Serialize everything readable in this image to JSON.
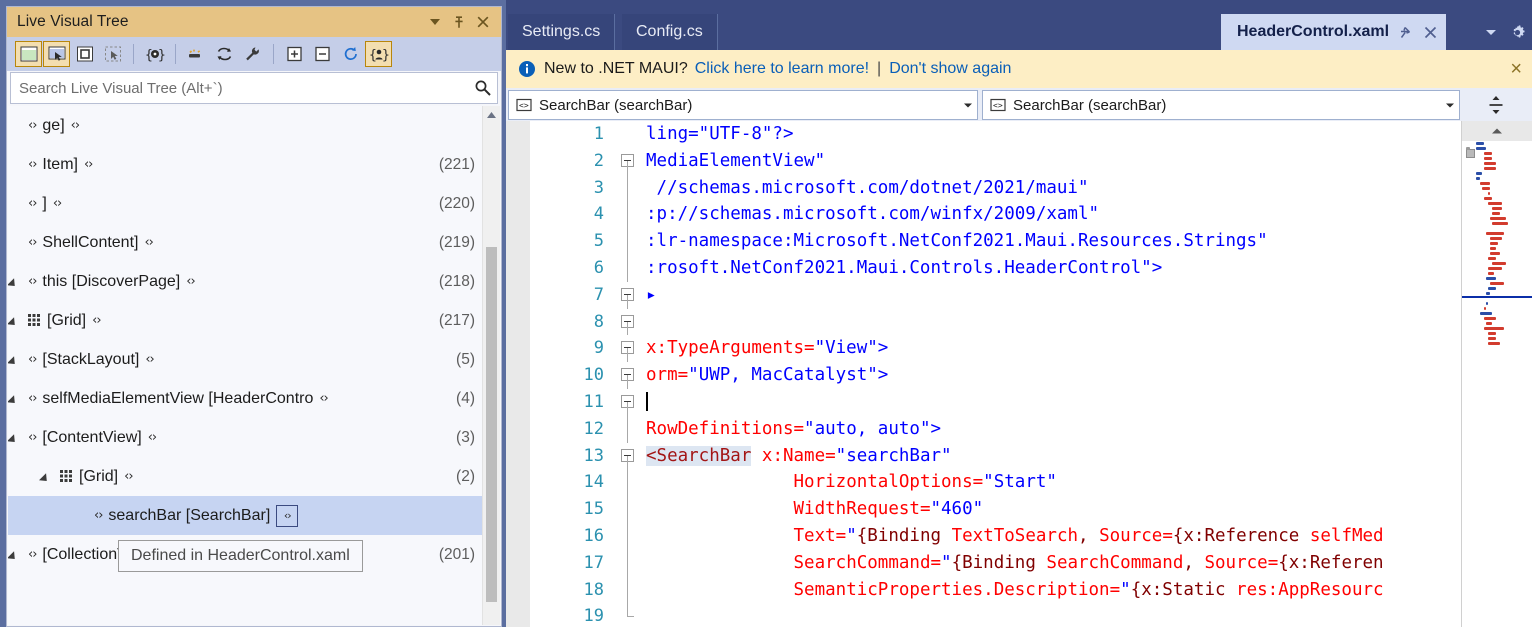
{
  "colors": {
    "tool_title_bg": "#e6c384",
    "tool_toolbar_bg": "#c5cee8",
    "shell_bg": "#5b6ea0",
    "tab_active_bg": "#cfd9f2",
    "tab_inactive_bg": "#36457a",
    "infobar_bg": "#fdeec5",
    "link": "#0a5fb8",
    "selection": "#c6d4f2",
    "linenumber": "#2b91af",
    "element": "#a31515",
    "attribute": "#ff0000",
    "value": "#0000ff"
  },
  "tool_window": {
    "title": "Live Visual Tree",
    "caret_label": "",
    "pin_label": "Pin",
    "close_label": "Close",
    "toolbar_icons": [
      "select-element-icon",
      "display-layout-adorners-icon",
      "preview-selection-icon",
      "track-focused-element-icon",
      "show-runtime-tools-icon",
      "show-in-xaml-editor-icon",
      "refresh-icon",
      "configure-icon",
      "expand-all-icon",
      "collapse-all-icon",
      "reload-icon",
      "show-only-my-xaml-icon"
    ],
    "search": {
      "placeholder": "Search Live Visual Tree (Alt+`)",
      "value": "",
      "icon": "search-icon"
    },
    "tree": [
      {
        "indent": 0,
        "expander": "none",
        "icon": "code-icon",
        "label": "ge]",
        "count": "",
        "selected": false
      },
      {
        "indent": 0,
        "expander": "none",
        "icon": "code-icon",
        "label": "Item]",
        "count": "(221)",
        "selected": false
      },
      {
        "indent": 0,
        "expander": "none",
        "icon": "code-icon",
        "label": "]",
        "count": "(220)",
        "selected": false
      },
      {
        "indent": 0,
        "expander": "none",
        "icon": "code-icon",
        "label": "ShellContent]",
        "count": "(219)",
        "selected": false
      },
      {
        "indent": 0,
        "expander": "open",
        "icon": "code-icon",
        "label": "this [DiscoverPage]",
        "count": "(218)",
        "selected": false
      },
      {
        "indent": 0,
        "expander": "open",
        "icon": "grid-icon",
        "label": "[Grid]",
        "count": "(217)",
        "selected": false
      },
      {
        "indent": 1,
        "expander": "open",
        "icon": "code-icon",
        "label": "[StackLayout]",
        "count": "(5)",
        "selected": false
      },
      {
        "indent": 2,
        "expander": "open",
        "icon": "code-icon",
        "label": "selfMediaElementView [HeaderContro",
        "count": "(4)",
        "selected": false
      },
      {
        "indent": 3,
        "expander": "open",
        "icon": "code-icon",
        "label": "[ContentView]",
        "count": "(3)",
        "selected": false
      },
      {
        "indent": 4,
        "expander": "open",
        "icon": "grid-icon",
        "label": "[Grid]",
        "count": "(2)",
        "selected": false
      },
      {
        "indent": 5,
        "expander": "none",
        "icon": "code-icon",
        "label": "searchBar [SearchBar]",
        "count": "",
        "selected": true,
        "badge": "code-badge-icon"
      },
      {
        "indent": 1,
        "expander": "open",
        "icon": "code-icon",
        "label": "[CollectionView]",
        "count": "(201)",
        "selected": false
      }
    ],
    "tooltip": "Defined in HeaderControl.xaml"
  },
  "tabs": [
    {
      "label": "Settings.cs",
      "active": false
    },
    {
      "label": "Config.cs",
      "active": false
    },
    {
      "label": "HeaderControl.xaml",
      "active": true,
      "pin_icon": "pin-icon",
      "close_icon": "close-icon"
    }
  ],
  "tab_tools": [
    "tab-list-caret-icon",
    "settings-gear-icon"
  ],
  "infobar": {
    "icon": "info-icon",
    "text": "New to .NET MAUI?",
    "link1": "Click here to learn more!",
    "separator": "|",
    "link2": "Don't show again",
    "close": "×"
  },
  "navbar": {
    "left": {
      "icon": "class-member-icon",
      "label": "SearchBar (searchBar)",
      "caret": "chevron-down-icon"
    },
    "right": {
      "icon": "class-member-icon",
      "label": "SearchBar (searchBar)",
      "caret": "chevron-down-icon"
    },
    "split_icon": "split-view-icon"
  },
  "code": {
    "lines": [
      {
        "n": "1",
        "fold": "none",
        "tokens": [
          {
            "t": "val",
            "s": "ling=\"UTF-8\"?>"
          }
        ]
      },
      {
        "n": "2",
        "fold": "box-top",
        "tokens": [
          {
            "t": "val",
            "s": "MediaElementView\""
          }
        ]
      },
      {
        "n": "3",
        "fold": "line",
        "tokens": [
          {
            "t": "val",
            "s": " //schemas.microsoft.com/dotnet/2021/maui\""
          }
        ]
      },
      {
        "n": "4",
        "fold": "line",
        "tokens": [
          {
            "t": "val",
            "s": ":p://schemas.microsoft.com/winfx/2009/xaml\""
          }
        ]
      },
      {
        "n": "5",
        "fold": "line",
        "tokens": [
          {
            "t": "val",
            "s": ":lr-namespace:Microsoft.NetConf2021.Maui.Resources.Strings\""
          }
        ]
      },
      {
        "n": "6",
        "fold": "line",
        "tokens": [
          {
            "t": "val",
            "s": ":rosoft.NetConf2021.Maui.Controls.HeaderControl\">"
          }
        ]
      },
      {
        "n": "7",
        "fold": "box",
        "tokens": [
          {
            "t": "val",
            "s": "▸"
          }
        ]
      },
      {
        "n": "8",
        "fold": "box",
        "tokens": [
          {
            "t": "blk",
            "s": ""
          }
        ]
      },
      {
        "n": "9",
        "fold": "box",
        "tokens": [
          {
            "t": "attr",
            "s": "x:TypeArguments="
          },
          {
            "t": "val",
            "s": "\"View\">"
          }
        ]
      },
      {
        "n": "10",
        "fold": "box",
        "tokens": [
          {
            "t": "attr",
            "s": "orm="
          },
          {
            "t": "val",
            "s": "\"UWP, MacCatalyst\">"
          }
        ]
      },
      {
        "n": "11",
        "fold": "box",
        "tokens": [
          {
            "t": "caret",
            "s": "|"
          }
        ]
      },
      {
        "n": "12",
        "fold": "line",
        "tokens": [
          {
            "t": "attr",
            "s": "RowDefinitions="
          },
          {
            "t": "val",
            "s": "\"auto, auto\">"
          }
        ]
      },
      {
        "n": "13",
        "fold": "box",
        "tokens": [
          {
            "t": "elh",
            "s": "<SearchBar"
          },
          {
            "t": "blk",
            "s": " "
          },
          {
            "t": "attr",
            "s": "x:Name="
          },
          {
            "t": "val",
            "s": "\"searchBar\""
          }
        ]
      },
      {
        "n": "14",
        "fold": "line",
        "tokens": [
          {
            "t": "blk",
            "s": "              "
          },
          {
            "t": "attr",
            "s": "HorizontalOptions="
          },
          {
            "t": "val",
            "s": "\"Start\""
          }
        ]
      },
      {
        "n": "15",
        "fold": "line",
        "tokens": [
          {
            "t": "blk",
            "s": "              "
          },
          {
            "t": "attr",
            "s": "WidthRequest="
          },
          {
            "t": "val",
            "s": "\"460\""
          }
        ]
      },
      {
        "n": "16",
        "fold": "line",
        "tokens": [
          {
            "t": "blk",
            "s": "              "
          },
          {
            "t": "attr",
            "s": "Text="
          },
          {
            "t": "val",
            "s": "\""
          },
          {
            "t": "mk",
            "s": "{Binding"
          },
          {
            "t": "attr",
            "s": " TextToSearch"
          },
          {
            "t": "mk",
            "s": ","
          },
          {
            "t": "attr",
            "s": " Source="
          },
          {
            "t": "mk",
            "s": "{x:Reference"
          },
          {
            "t": "attr",
            "s": " selfMed"
          }
        ]
      },
      {
        "n": "17",
        "fold": "line",
        "tokens": [
          {
            "t": "blk",
            "s": "              "
          },
          {
            "t": "attr",
            "s": "SearchCommand="
          },
          {
            "t": "val",
            "s": "\""
          },
          {
            "t": "mk",
            "s": "{Binding"
          },
          {
            "t": "attr",
            "s": " SearchCommand"
          },
          {
            "t": "mk",
            "s": ","
          },
          {
            "t": "attr",
            "s": " Source="
          },
          {
            "t": "mk",
            "s": "{x:Referen"
          }
        ]
      },
      {
        "n": "18",
        "fold": "line",
        "tokens": [
          {
            "t": "blk",
            "s": "              "
          },
          {
            "t": "attr",
            "s": "SemanticProperties.Description="
          },
          {
            "t": "val",
            "s": "\""
          },
          {
            "t": "mk",
            "s": "{x:Static"
          },
          {
            "t": "attr",
            "s": " res:AppResourc"
          }
        ]
      },
      {
        "n": "19",
        "fold": "half",
        "tokens": [
          {
            "t": "blk",
            "s": ""
          }
        ]
      }
    ]
  },
  "minimap": {
    "rows": [
      [
        [
          14,
          22,
          "#2b4fa8"
        ]
      ],
      [
        [
          4,
          8,
          "#9a9a9a"
        ],
        [
          14,
          24,
          "#2b4fa8"
        ]
      ],
      [
        [
          22,
          30,
          "#d23c2e"
        ]
      ],
      [
        [
          22,
          30,
          "#d23c2e"
        ]
      ],
      [
        [
          22,
          34,
          "#d23c2e"
        ]
      ],
      [
        [
          22,
          34,
          "#d23c2e"
        ]
      ],
      [
        [
          14,
          20,
          "#2b4fa8"
        ]
      ],
      [
        [
          14,
          18,
          "#2b4fa8"
        ]
      ],
      [
        [
          18,
          28,
          "#d23c2e"
        ]
      ],
      [
        [
          20,
          28,
          "#d23c2e"
        ]
      ],
      [
        [
          26,
          28,
          "#d23c2e"
        ]
      ],
      [
        [
          22,
          30,
          "#d23c2e"
        ]
      ],
      [
        [
          26,
          40,
          "#d23c2e"
        ]
      ],
      [
        [
          30,
          40,
          "#d23c2e"
        ]
      ],
      [
        [
          30,
          38,
          "#d23c2e"
        ]
      ],
      [
        [
          28,
          44,
          "#d23c2e"
        ]
      ],
      [
        [
          30,
          46,
          "#d23c2e"
        ]
      ],
      [],
      [
        [
          24,
          42,
          "#d23c2e"
        ]
      ],
      [
        [
          28,
          40,
          "#d23c2e"
        ]
      ],
      [
        [
          28,
          36,
          "#d23c2e"
        ]
      ],
      [
        [
          28,
          34,
          "#d23c2e"
        ]
      ],
      [
        [
          28,
          38,
          "#d23c2e"
        ]
      ],
      [
        [
          26,
          34,
          "#d23c2e"
        ]
      ],
      [
        [
          30,
          44,
          "#d23c2e"
        ]
      ],
      [
        [
          26,
          40,
          "#d23c2e"
        ]
      ],
      [
        [
          26,
          32,
          "#d23c2e"
        ]
      ],
      [
        [
          24,
          34,
          "#2b4fa8"
        ]
      ],
      [
        [
          28,
          42,
          "#d23c2e"
        ]
      ],
      [
        [
          26,
          34,
          "#2b4fa8"
        ]
      ],
      [
        [
          24,
          28,
          "#2b4fa8"
        ]
      ],
      [],
      [
        [
          24,
          26,
          "#2b4fa8"
        ]
      ],
      [
        [
          22,
          24,
          "#d23c2e"
        ]
      ],
      [
        [
          18,
          30,
          "#2b4fa8"
        ]
      ],
      [
        [
          22,
          34,
          "#d23c2e"
        ]
      ],
      [
        [
          24,
          30,
          "#d23c2e"
        ]
      ],
      [
        [
          22,
          42,
          "#d23c2e"
        ]
      ],
      [
        [
          26,
          34,
          "#d23c2e"
        ]
      ],
      [
        [
          26,
          34,
          "#d23c2e"
        ]
      ],
      [
        [
          26,
          38,
          "#d23c2e"
        ]
      ]
    ]
  }
}
